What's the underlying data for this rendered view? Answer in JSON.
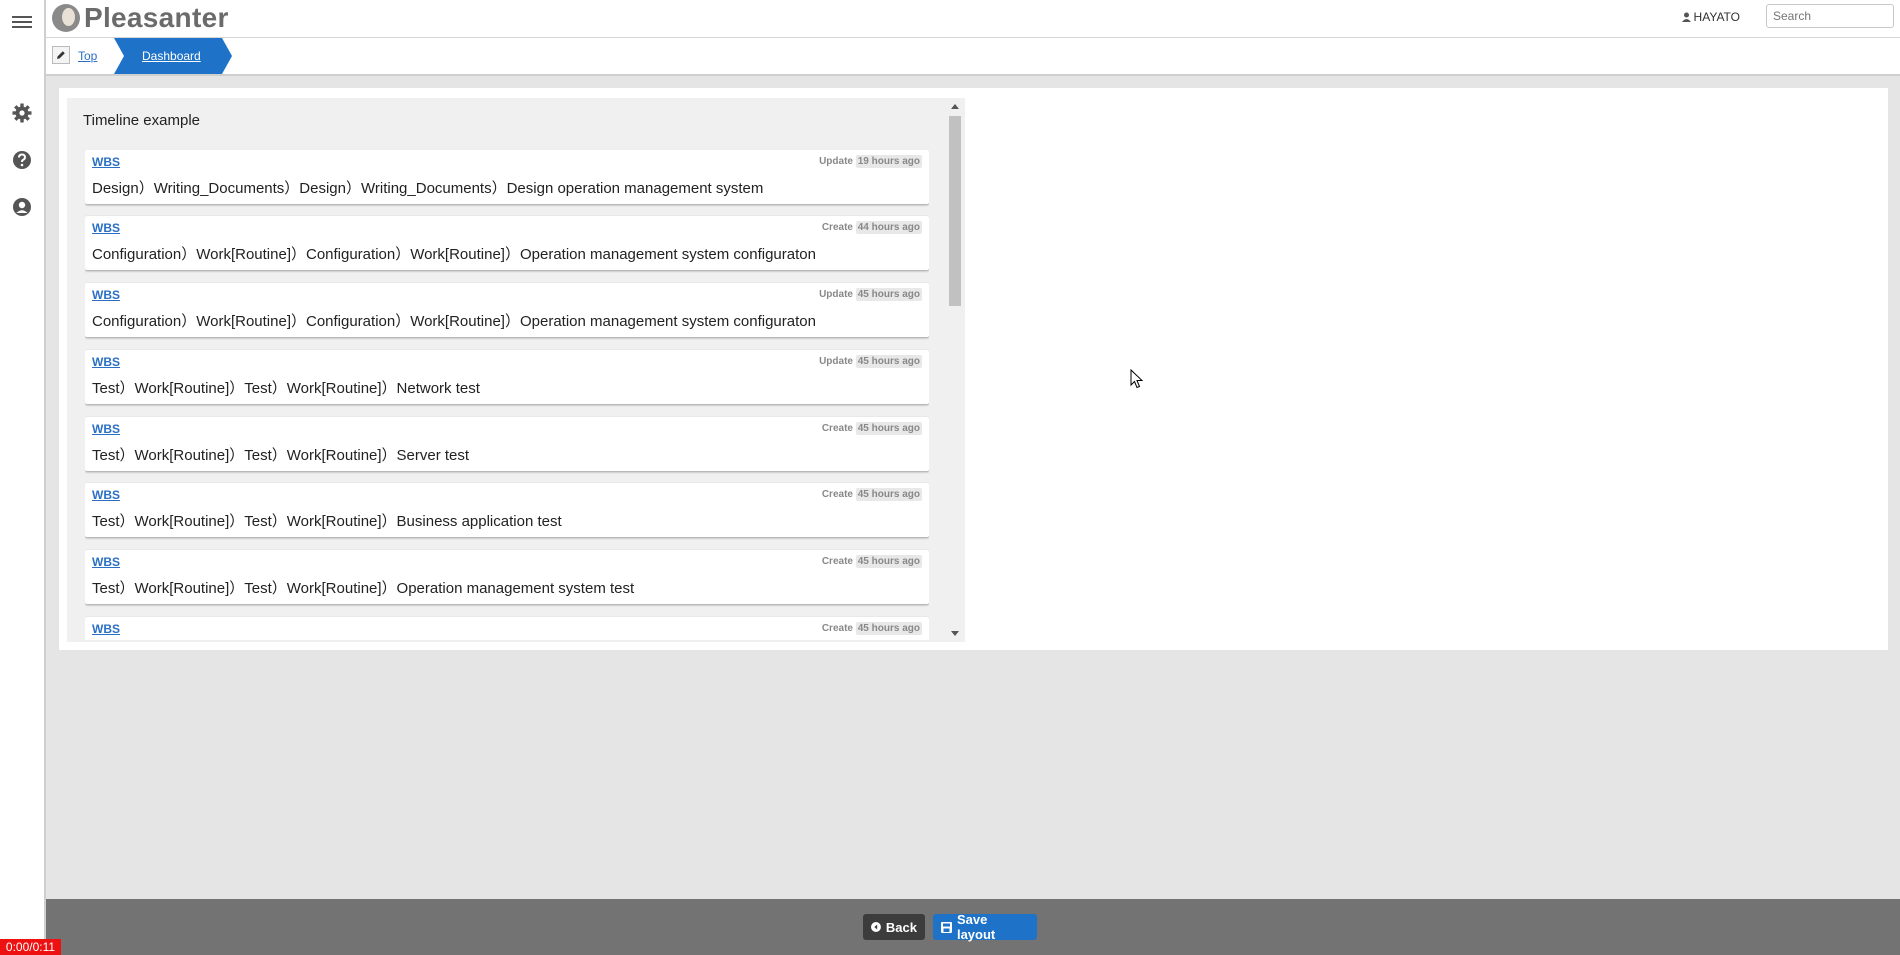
{
  "app": {
    "name": "Pleasanter"
  },
  "header": {
    "user_name": "HAYATO",
    "search_placeholder": "Search"
  },
  "breadcrumb": {
    "top_label": "Top",
    "dashboard_label": "Dashboard"
  },
  "timeline": {
    "title": "Timeline example",
    "items": [
      {
        "link": "WBS",
        "action": "Update",
        "time": "19 hours ago",
        "text": "Design）Writing_Documents）Design）Writing_Documents）Design operation management system"
      },
      {
        "link": "WBS",
        "action": "Create",
        "time": "44 hours ago",
        "text": "Configuration）Work[Routine]）Configuration）Work[Routine]）Operation management system configuraton"
      },
      {
        "link": "WBS",
        "action": "Update",
        "time": "45 hours ago",
        "text": "Configuration）Work[Routine]）Configuration）Work[Routine]）Operation management system configuraton"
      },
      {
        "link": "WBS",
        "action": "Update",
        "time": "45 hours ago",
        "text": "Test）Work[Routine]）Test）Work[Routine]）Network test"
      },
      {
        "link": "WBS",
        "action": "Create",
        "time": "45 hours ago",
        "text": "Test）Work[Routine]）Test）Work[Routine]）Server test"
      },
      {
        "link": "WBS",
        "action": "Create",
        "time": "45 hours ago",
        "text": "Test）Work[Routine]）Test）Work[Routine]）Business application test"
      },
      {
        "link": "WBS",
        "action": "Create",
        "time": "45 hours ago",
        "text": "Test）Work[Routine]）Test）Work[Routine]）Operation management system test"
      },
      {
        "link": "WBS",
        "action": "Create",
        "time": "45 hours ago",
        "text": ""
      }
    ]
  },
  "footer": {
    "back_label": "Back",
    "save_label": "Save layout"
  },
  "recording": {
    "timer": "0:00/0:11"
  },
  "colors": {
    "accent": "#1e72c7",
    "link": "#2a6fc4",
    "timer_bg": "#ee1111"
  },
  "icons": [
    "menu-icon",
    "gear-icon",
    "help-icon",
    "account-icon",
    "user-icon",
    "pencil-icon",
    "arrow-left-icon",
    "save-icon"
  ]
}
